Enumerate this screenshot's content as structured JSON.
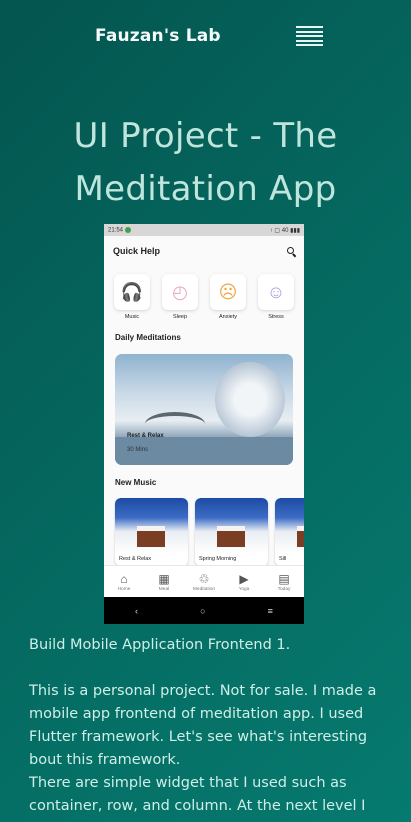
{
  "nav": {
    "brand": "Fauzan's Lab",
    "menu_icon": "hamburger-icon"
  },
  "title_line1": "UI Project - The",
  "title_line2": "Meditation App",
  "phone": {
    "status_left": "21:54",
    "status_right": "↑ ▢ 40 ▮▮▮",
    "header_title": "Quick Help",
    "categories": [
      {
        "label": "Music",
        "icon": "headphones-icon",
        "glyph": "🎧",
        "color": "#6ecde0"
      },
      {
        "label": "Sleep",
        "icon": "clock-icon",
        "glyph": "◴",
        "color": "#e8a7c1"
      },
      {
        "label": "Anxiety",
        "icon": "sad-face-icon",
        "glyph": "☹",
        "color": "#f1a545"
      },
      {
        "label": "Stress",
        "icon": "smile-face-icon",
        "glyph": "☺",
        "color": "#a99ee0"
      }
    ],
    "daily_title": "Daily Meditations",
    "feature_title": "Rest & Relax",
    "feature_duration": "30 Mins",
    "music_title": "New Music",
    "music_cards": [
      "Rest & Relax",
      "Spring Morning",
      "Sill"
    ],
    "bottom_nav": [
      {
        "label": "Home",
        "icon": "home-icon",
        "glyph": "⌂"
      },
      {
        "label": "Meal",
        "icon": "meal-icon",
        "glyph": "▦"
      },
      {
        "label": "Meditation",
        "icon": "meditation-icon",
        "glyph": "♲"
      },
      {
        "label": "Yoga",
        "icon": "video-icon",
        "glyph": "▶"
      },
      {
        "label": "Today",
        "icon": "calendar-icon",
        "glyph": "▤"
      }
    ],
    "sys": [
      "‹",
      "○",
      "≡"
    ]
  },
  "body": {
    "line1": "Build Mobile Application Frontend 1.",
    "para": "This is a personal project. Not for sale. I made a mobile app frontend of meditation app. I used Flutter framework. Let's see what's interesting bout this framework.",
    "para2": "There are simple widget that I used such as container, row, and column. At the next level I"
  }
}
